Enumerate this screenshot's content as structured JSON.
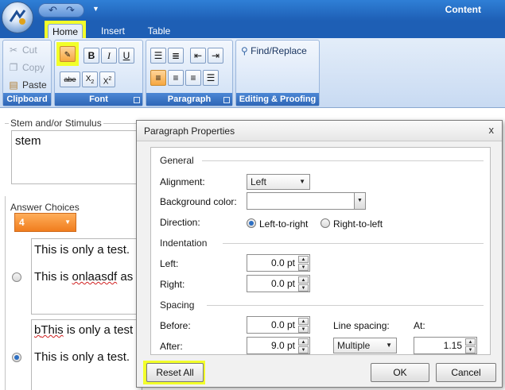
{
  "window": {
    "title": "Content"
  },
  "tabs": [
    {
      "label": "Home",
      "active": true
    },
    {
      "label": "Insert",
      "active": false
    },
    {
      "label": "Table",
      "active": false
    }
  ],
  "ribbon": {
    "clipboard": {
      "label": "Clipboard",
      "cut": "Cut",
      "copy": "Copy",
      "paste": "Paste"
    },
    "font": {
      "label": "Font",
      "bold": "B",
      "italic": "I",
      "underline": "U",
      "strike": "abe",
      "subscript": "X",
      "subscript_mark": "2",
      "superscript": "X",
      "superscript_mark": "2"
    },
    "paragraph": {
      "label": "Paragraph"
    },
    "editing": {
      "label": "Editing & Proofing",
      "find_replace": "Find/Replace"
    }
  },
  "editor": {
    "stem_label": "Stem and/or Stimulus",
    "stem_value": "stem",
    "answers_label": "Answer Choices",
    "answer_count": "4",
    "choices": [
      {
        "line1": "This is only a test.",
        "line2a": "This is ",
        "line2b": "onlaasdf",
        "line2c": " as",
        "selected": false
      },
      {
        "line1a": "b",
        "line1b": "This",
        "line1c": " is only a test",
        "line2": "This is only a test.",
        "selected": true
      }
    ]
  },
  "dialog": {
    "title": "Paragraph Properties",
    "close": "x",
    "general": "General",
    "alignment_label": "Alignment:",
    "alignment_value": "Left",
    "bg_color_label": "Background color:",
    "direction_label": "Direction:",
    "ltr": "Left-to-right",
    "rtl": "Right-to-left",
    "direction_selected": "Left-to-right",
    "indentation": "Indentation",
    "left_label": "Left:",
    "left_value": "0.0 pt",
    "right_label": "Right:",
    "right_value": "0.0 pt",
    "spacing": "Spacing",
    "before_label": "Before:",
    "before_value": "0.0 pt",
    "after_label": "After:",
    "after_value": "9.0 pt",
    "line_spacing_label": "Line spacing:",
    "line_spacing_value": "Multiple",
    "at_label": "At:",
    "at_value": "1.15",
    "reset_all": "Reset All",
    "ok": "OK",
    "cancel": "Cancel"
  },
  "colors": {
    "ribbon_blue": "#2f67b7",
    "highlight_yellow": "#f2ff2a",
    "accent_orange": "#f07d1e"
  }
}
